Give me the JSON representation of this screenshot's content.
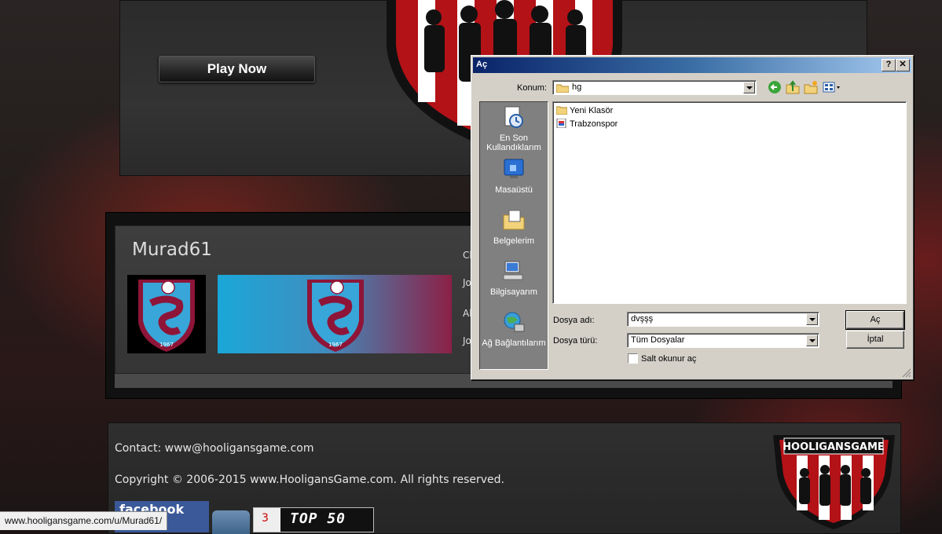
{
  "page": {
    "play_button": "Play Now",
    "username": "Murad61",
    "side_labels": [
      "Cl",
      "Jo",
      "Al",
      "Jo"
    ],
    "crest_year": "1967",
    "footer": {
      "contact": "Contact: www@hooligansgame.com",
      "copyright": "Copyright © 2006-2015 www.HooligansGame.com. All rights reserved.",
      "facebook_label": "facebook",
      "top50_rank": "3",
      "top50_label": "TOP 50",
      "brand_logo": "HOOLIGANSGAME"
    },
    "status_url": "www.hooligansgame.com/u/Murad61/"
  },
  "dialog": {
    "title": "Aç",
    "help_button": "?",
    "close_button": "✕",
    "location_label": "Konum:",
    "location_value": "hg",
    "places": [
      {
        "label": "En Son Kullandıklarım",
        "icon": "recent-documents-icon"
      },
      {
        "label": "Masaüstü",
        "icon": "desktop-icon"
      },
      {
        "label": "Belgelerim",
        "icon": "my-documents-icon"
      },
      {
        "label": "Bilgisayarım",
        "icon": "my-computer-icon"
      },
      {
        "label": "Ağ Bağlantılarım",
        "icon": "network-icon"
      }
    ],
    "files": [
      {
        "name": "Yeni Klasör",
        "icon": "folder-icon"
      },
      {
        "name": "Trabzonspor",
        "icon": "image-file-icon"
      }
    ],
    "filename_label": "Dosya adı:",
    "filename_value": "dvşşş",
    "filetype_label": "Dosya türü:",
    "filetype_value": "Tüm Dosyalar",
    "readonly_label": "Salt okunur aç",
    "open_button": "Aç",
    "cancel_button": "İptal"
  }
}
